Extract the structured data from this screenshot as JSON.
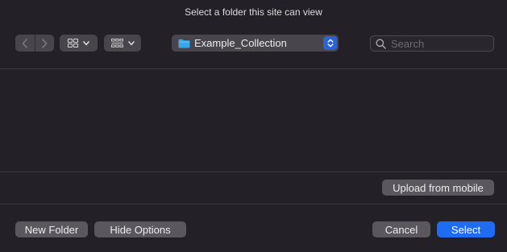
{
  "dialog": {
    "title": "Select a folder this site can view"
  },
  "toolbar": {
    "back_icon": "chevron-left-icon",
    "forward_icon": "chevron-right-icon",
    "view_mode_icon": "icon-grid-icon",
    "group_icon": "group-grid-icon",
    "location": {
      "folder_icon": "folder-icon",
      "label": "Example_Collection"
    },
    "search": {
      "placeholder": "Search",
      "value": ""
    }
  },
  "actions": {
    "upload_label": "Upload from mobile",
    "new_folder_label": "New Folder",
    "hide_options_label": "Hide Options",
    "cancel_label": "Cancel",
    "select_label": "Select"
  },
  "colors": {
    "background": "#232127",
    "control": "#48464c",
    "accent": "#1f6bf2",
    "folder": "#3aa7e8"
  }
}
